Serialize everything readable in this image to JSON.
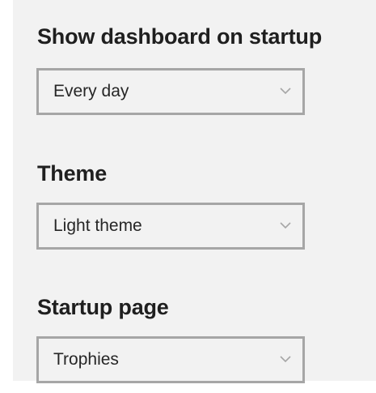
{
  "settings": [
    {
      "label": "Show dashboard on startup",
      "selected": "Every day",
      "icon": "chevron-down-icon"
    },
    {
      "label": "Theme",
      "selected": "Light theme",
      "icon": "chevron-down-icon"
    },
    {
      "label": "Startup page",
      "selected": "Trophies",
      "icon": "chevron-down-icon"
    }
  ],
  "colors": {
    "panel_background": "#f2f2f2",
    "dropdown_border": "#a6a6a6",
    "label_text": "#1f1f1f",
    "chevron": "#a6a6a6"
  }
}
